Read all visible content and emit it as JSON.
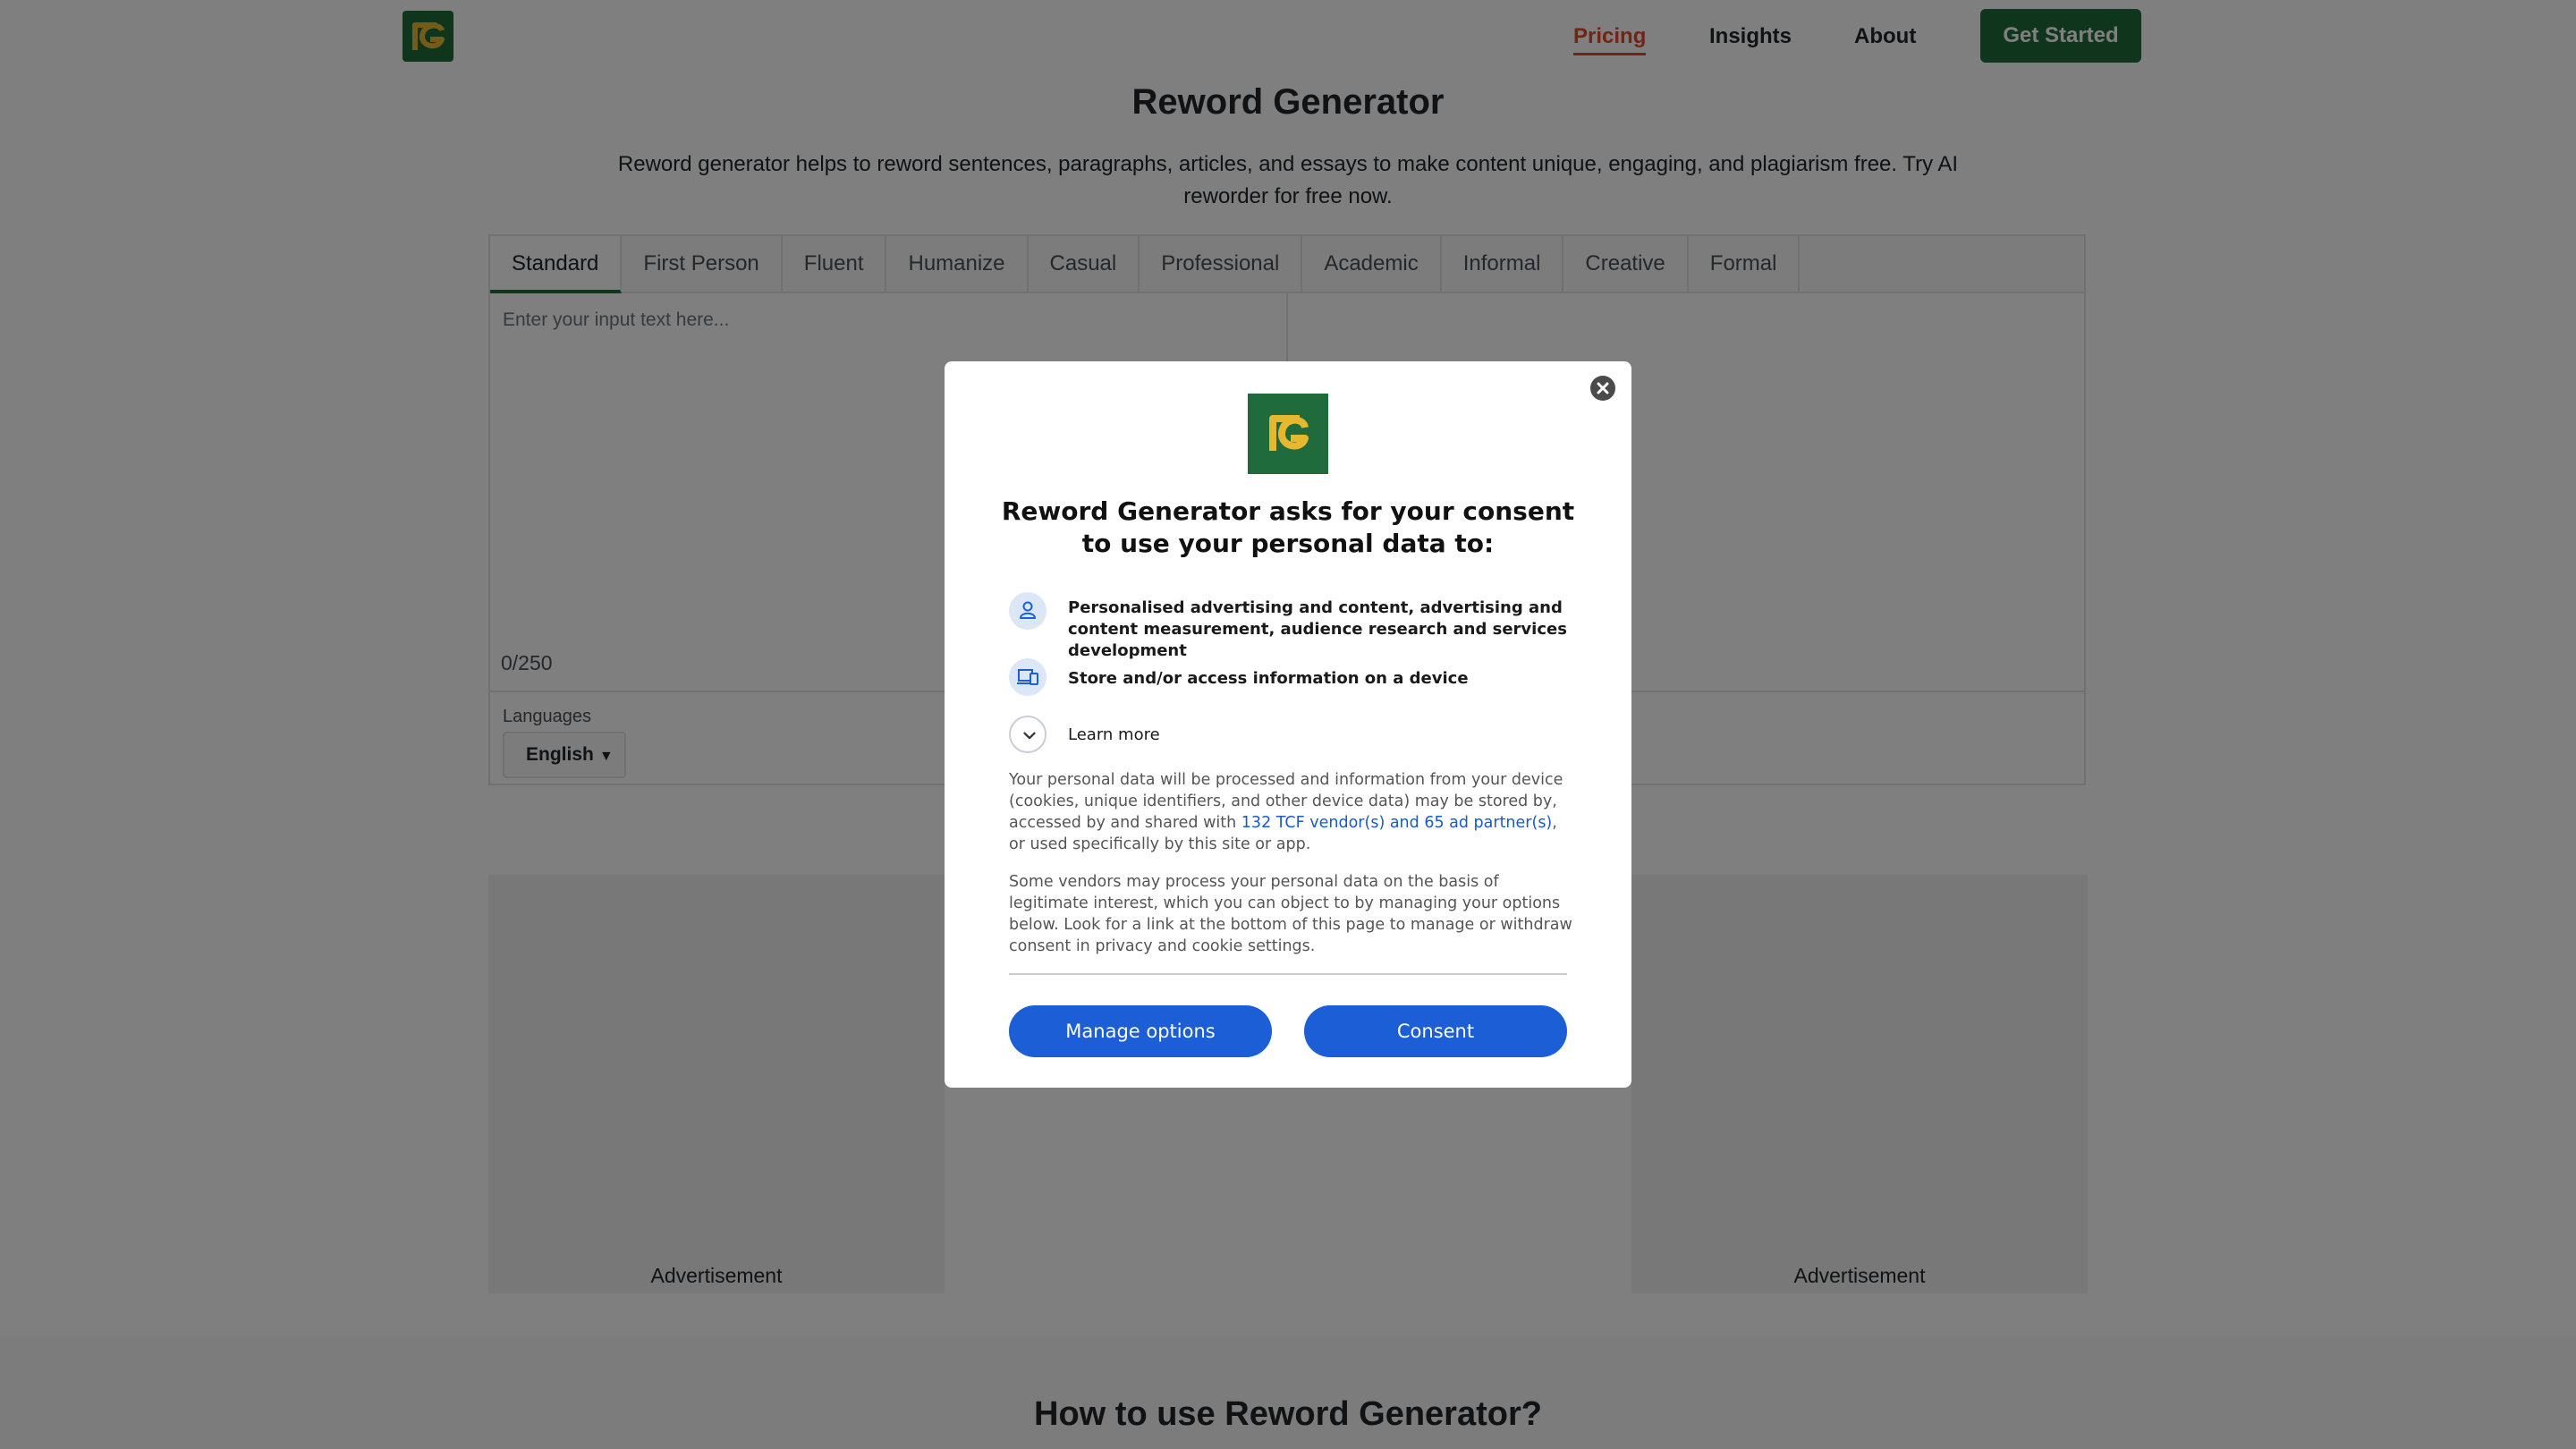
{
  "header": {
    "nav": {
      "pricing": "Pricing",
      "insights": "Insights",
      "about": "About"
    },
    "cta_label": "Get Started"
  },
  "hero": {
    "title": "Reword Generator",
    "subtitle": "Reword generator helps to reword sentences, paragraphs, articles, and essays to make content unique, engaging, and plagiarism free. Try AI reworder for free now."
  },
  "editor": {
    "tabs": [
      "Standard",
      "First Person",
      "Fluent",
      "Humanize",
      "Casual",
      "Professional",
      "Academic",
      "Informal",
      "Creative",
      "Formal"
    ],
    "active_tab": "Standard",
    "input_placeholder": "Enter your input text here...",
    "char_count": "0/250",
    "languages_label": "Languages",
    "language_value": "English"
  },
  "ads": {
    "left_label": "Advertisement",
    "right_label": "Advertisement"
  },
  "section": {
    "how_title": "How to use Reword Generator?"
  },
  "consent": {
    "title": "Reword Generator asks for your consent to use your personal data to:",
    "purposes": [
      {
        "icon": "person-icon",
        "text": "Personalised advertising and content, advertising and content measurement, audience research and services development"
      },
      {
        "icon": "device-icon",
        "text": "Store and/or access information on a device"
      }
    ],
    "learn_more": "Learn more",
    "body_1_before": "Your personal data will be processed and information from your device (cookies, unique identifiers, and other device data) may be stored by, accessed by and shared with ",
    "vendor_link": "132 TCF vendor(s) and 65 ad partner(s)",
    "body_1_after": ", or used specifically by this site or app.",
    "body_2": "Some vendors may process your personal data on the basis of legitimate interest, which you can object to by managing your options below. Look for a link at the bottom of this page to manage or withdraw consent in privacy and cookie settings.",
    "manage_label": "Manage options",
    "consent_label": "Consent"
  },
  "colors": {
    "brand_green": "#1f6b3b",
    "brand_yellow": "#e6b830",
    "pricing_active": "#e8472b",
    "consent_blue": "#1c5ed6",
    "link_blue": "#1a5bc8"
  }
}
